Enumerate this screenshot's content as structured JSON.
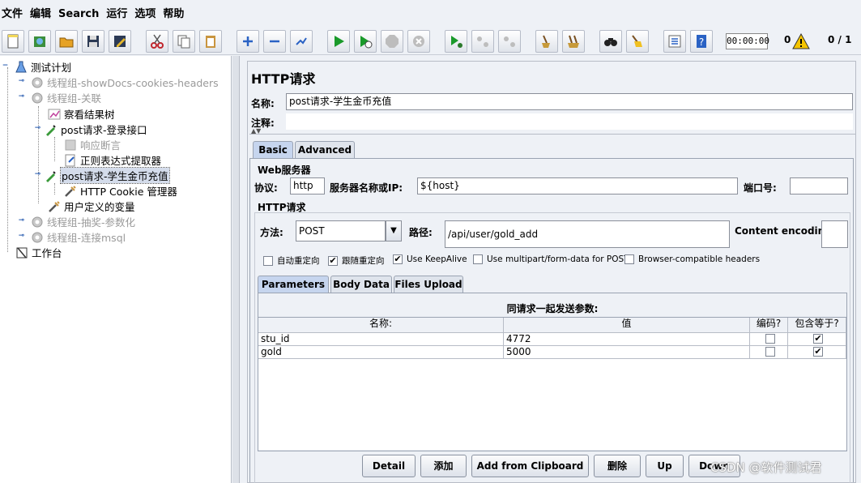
{
  "menu": [
    "文件",
    "编辑",
    "Search",
    "运行",
    "选项",
    "帮助"
  ],
  "toolbar": {
    "timer": "00:00:00",
    "warnings": "0",
    "threads": "0 / 1",
    "colors": {
      "run": "#1a9a2a",
      "warn": "#f5c400"
    }
  },
  "tree": {
    "root": "测试计划",
    "items": [
      "线程组-showDocs-cookies-headers",
      "线程组-关联",
      "察看结果树",
      "post请求-登录接口",
      "响应断言",
      "正则表达式提取器",
      "post请求-学生金币充值",
      "HTTP Cookie 管理器",
      "用户定义的变量",
      "线程组-抽奖-参数化",
      "线程组-连接msql"
    ],
    "workbench": "工作台"
  },
  "panel": {
    "title": "HTTP请求",
    "name_label": "名称:",
    "name_value": "post请求-学生金币充值",
    "comment_label": "注释:",
    "tabs": [
      "Basic",
      "Advanced"
    ],
    "web_server": {
      "title": "Web服务器",
      "protocol_label": "协议:",
      "protocol_value": "http",
      "host_label": "服务器名称或IP:",
      "host_value": "${host}",
      "port_label": "端口号:",
      "port_value": ""
    },
    "http_request": {
      "title": "HTTP请求",
      "method_label": "方法:",
      "method_value": "POST",
      "path_label": "路径:",
      "path_value": "/api/user/gold_add",
      "encoding_label": "Content encoding:",
      "encoding_value": ""
    },
    "options": [
      {
        "label": "自动重定向",
        "checked": false
      },
      {
        "label": "跟随重定向",
        "checked": true
      },
      {
        "label": "Use KeepAlive",
        "checked": true
      },
      {
        "label": "Use multipart/form-data for POST",
        "checked": false
      },
      {
        "label": "Browser-compatible headers",
        "checked": false
      }
    ],
    "sub_tabs": [
      "Parameters",
      "Body Data",
      "Files Upload"
    ],
    "params": {
      "caption": "同请求一起发送参数:",
      "headers": [
        "名称:",
        "值",
        "编码?",
        "包含等于?"
      ],
      "rows": [
        {
          "name": "stu_id",
          "value": "4772",
          "encode": false,
          "include_equals": true
        },
        {
          "name": "gold",
          "value": "5000",
          "encode": false,
          "include_equals": true
        }
      ]
    },
    "buttons": [
      "Detail",
      "添加",
      "Add from Clipboard",
      "删除",
      "Up",
      "Down"
    ]
  },
  "watermark": "CSDN @软件测试君"
}
